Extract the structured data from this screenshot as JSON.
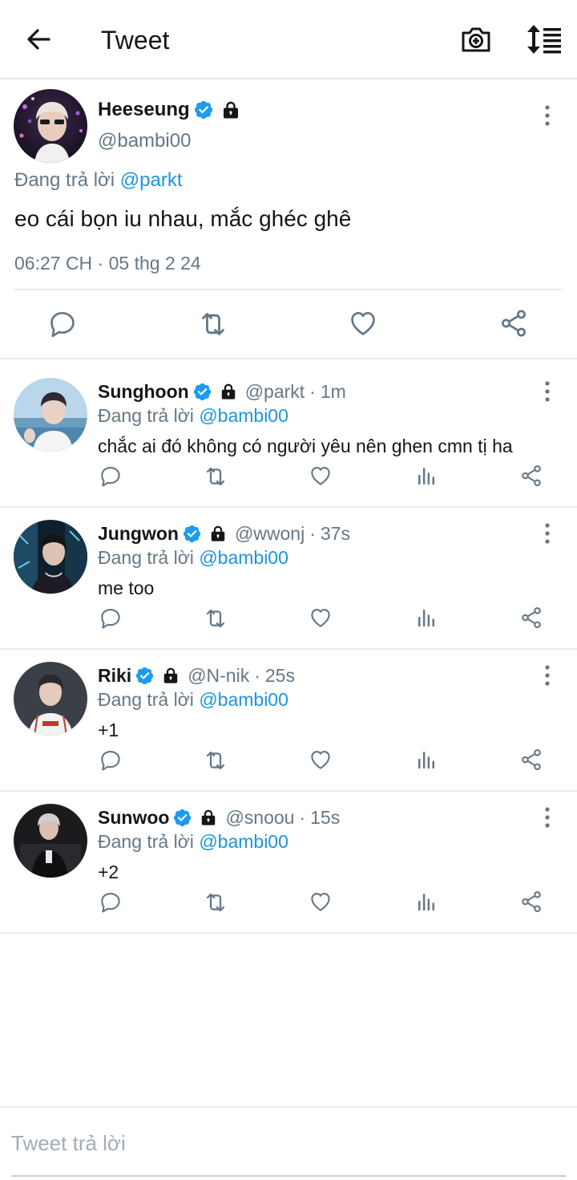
{
  "header": {
    "title": "Tweet"
  },
  "main_tweet": {
    "name": "Heeseung",
    "handle": "@bambi00",
    "replying_prefix": "Đang trả lời",
    "replying_to": "@parkt",
    "text": "eo cái bọn iu nhau, mắc ghéc ghê",
    "timestamp": "06:27 CH · 05 thg 2 24"
  },
  "replies": [
    {
      "name": "Sunghoon",
      "handle": "@parkt",
      "time": "1m",
      "replying_prefix": "Đang trả lời",
      "replying_to": "@bambi00",
      "text": "chắc ai đó không có người yêu nên ghen cmn tị ha"
    },
    {
      "name": "Jungwon",
      "handle": "@wwonj",
      "time": "37s",
      "replying_prefix": "Đang trả lời",
      "replying_to": "@bambi00",
      "text": "me too"
    },
    {
      "name": "Riki",
      "handle": "@N-nik",
      "time": "25s",
      "replying_prefix": "Đang trả lời",
      "replying_to": "@bambi00",
      "text": "+1"
    },
    {
      "name": "Sunwoo",
      "handle": "@snoou",
      "time": "15s",
      "replying_prefix": "Đang trả lời",
      "replying_to": "@bambi00",
      "text": "+2"
    }
  ],
  "compose": {
    "placeholder": "Tweet trả lời"
  },
  "colors": {
    "accent": "#1b95e0",
    "verified": "#1d9bf0",
    "muted": "#657786",
    "icon": "#657786",
    "divider": "#e6ecf0"
  },
  "icons": [
    "back-arrow-icon",
    "camera-plus-icon",
    "sort-icon",
    "verified-badge-icon",
    "lock-icon",
    "more-vertical-icon",
    "reply-icon",
    "retweet-icon",
    "like-icon",
    "analytics-icon",
    "share-icon"
  ]
}
